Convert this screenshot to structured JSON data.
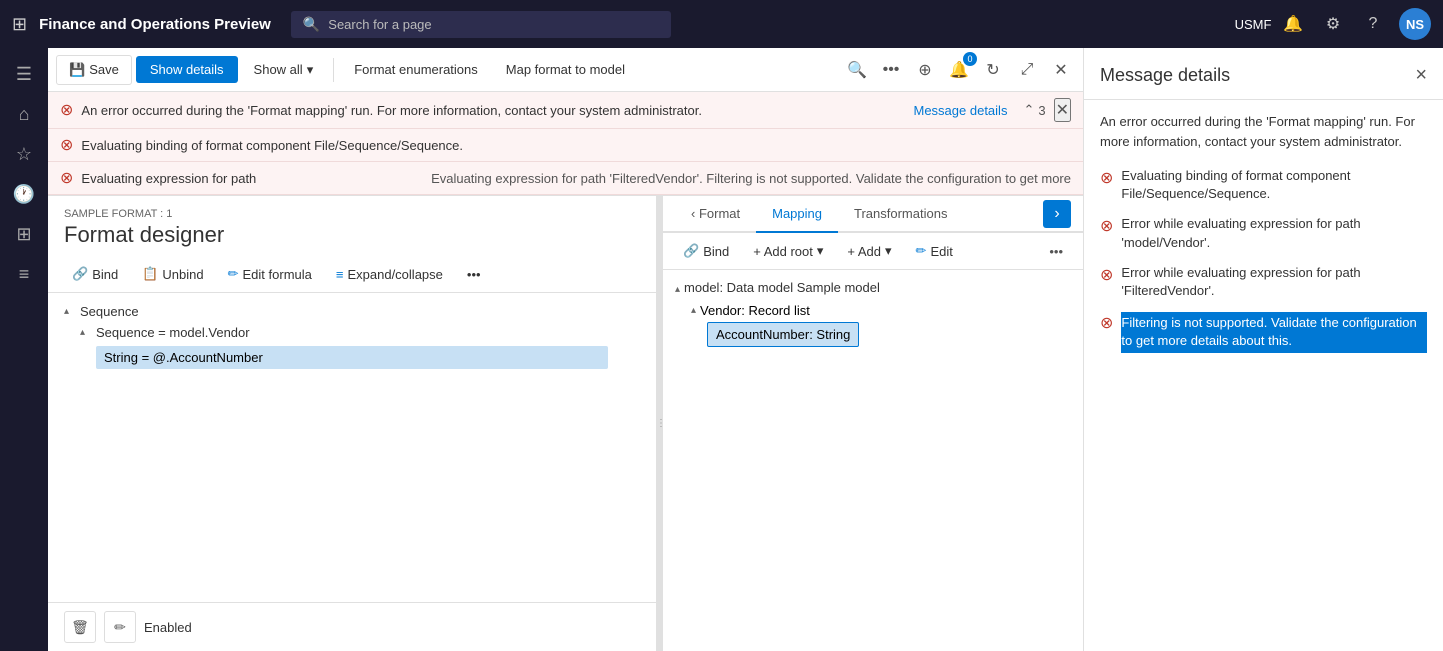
{
  "topNav": {
    "gridIcon": "⊞",
    "appTitle": "Finance and Operations Preview",
    "searchPlaceholder": "Search for a page",
    "orgLabel": "USMF",
    "avatarInitials": "NS"
  },
  "toolbar": {
    "saveLabel": "Save",
    "showDetailsLabel": "Show details",
    "showAllLabel": "Show all",
    "formatEnumLabel": "Format enumerations",
    "mapFormatLabel": "Map format to model",
    "badgeCount": "0"
  },
  "errors": [
    {
      "text": "An error occurred during the 'Format mapping' run. For more information, contact your system administrator.",
      "linkText": "Message details",
      "navCount": "3"
    },
    {
      "text": "Evaluating binding of format component File/Sequence/Sequence."
    },
    {
      "text": "Evaluating expression for path",
      "detailText": "Evaluating expression for path 'FilteredVendor'. Filtering is not supported. Validate the configuration to get more"
    }
  ],
  "designer": {
    "sampleLabel": "SAMPLE FORMAT : 1",
    "title": "Format designer",
    "bindLabel": "Bind",
    "unbindLabel": "Unbind",
    "editFormulaLabel": "Edit formula",
    "expandCollapseLabel": "Expand/collapse",
    "treeItems": [
      {
        "label": "Sequence",
        "level": 0,
        "arrow": "▴"
      },
      {
        "label": "Sequence = model.Vendor",
        "level": 1,
        "arrow": "▴"
      },
      {
        "label": "String = @.AccountNumber",
        "level": 2,
        "selected": true
      }
    ]
  },
  "mapping": {
    "formatTabLabel": "Format",
    "mappingTabLabel": "Mapping",
    "transformationsTabLabel": "Transformations",
    "bindLabel": "Bind",
    "addRootLabel": "+ Add root",
    "addLabel": "+ Add",
    "editLabel": "Edit",
    "modelLabel": "model: Data model Sample model",
    "vendorLabel": "Vendor: Record list",
    "accountNumberLabel": "AccountNumber: String"
  },
  "bottomBar": {
    "deleteIcon": "🗑",
    "editIcon": "✏",
    "enabledLabel": "Enabled"
  },
  "messageDetails": {
    "title": "Message details",
    "closeIcon": "×",
    "description": "An error occurred during the 'Format mapping' run. For more information, contact your system administrator.",
    "errors": [
      {
        "text": "Evaluating binding of format component File/Sequence/Sequence."
      },
      {
        "text": "Error while evaluating expression for path 'model/Vendor'."
      },
      {
        "text": "Error while evaluating expression for path 'FilteredVendor'."
      },
      {
        "text": "Filtering is not supported. Validate the configuration to get more details about this.",
        "highlight": true
      }
    ]
  }
}
